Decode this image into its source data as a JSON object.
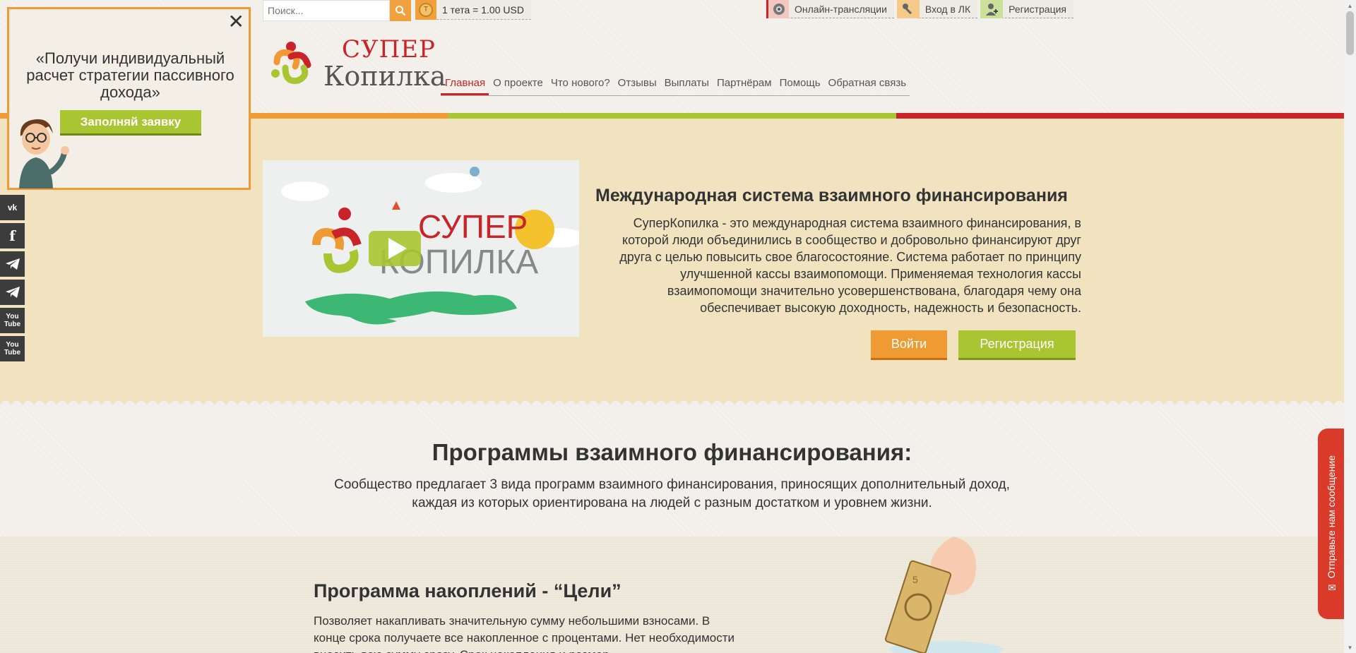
{
  "search": {
    "placeholder": "Поиск..."
  },
  "rate": {
    "coin_symbol": "T",
    "text": "1 тета = 1.00 USD"
  },
  "toplinks": [
    {
      "label": "Онлайн-трансляции",
      "icon": "broadcast-icon"
    },
    {
      "label": "Вход в ЛК",
      "icon": "key-icon"
    },
    {
      "label": "Регистрация",
      "icon": "user-add-icon"
    }
  ],
  "logo": {
    "line1": "СУПЕР",
    "line2": "Копилка"
  },
  "nav": [
    "Главная",
    "О проекте",
    "Что нового?",
    "Отзывы",
    "Выплаты",
    "Партнёрам",
    "Помощь",
    "Обратная связь"
  ],
  "colors": {
    "orange": "#ef9a33",
    "green": "#a9c531",
    "red": "#c8242a",
    "hero_bg": "#f1e3c0"
  },
  "video": {
    "logo_line1": "СУПЕР",
    "logo_line2": "КОПИЛКА"
  },
  "hero": {
    "title": "Международная система взаимного финансирования",
    "description": "СуперКопилка - это международная система взаимного финансирования, в которой люди объединились в сообщество и добровольно финансируют друг друга с целью повысить свое благосостояние. Система работает по принципу улучшенной кассы взаимопомощи. Применяемая технология кассы взаимопомощи значительно усовершенствована, благодаря чему она обеспечивает высокую доходность, надежность и безопасность.",
    "login_button": "Войти",
    "register_button": "Регистрация"
  },
  "programs": {
    "title": "Программы взаимного финансирования:",
    "text_line1": "Сообщество предлагает 3 вида программ взаимного финансирования, приносящих дополнительный доход,",
    "text_line2": "каждая из которых ориентирована на людей с разным достатком и уровнем жизни."
  },
  "savings": {
    "title": "Программа накоплений - “Цели”",
    "text": "Позволяет накапливать значительную сумму небольшими взносами. В конце срока получаете все накопленное с процентами. Нет необходимости вносить всю сумму сразу. Срок накопления и размер"
  },
  "popup": {
    "close": "✕",
    "text": "«Получи индивидуальный расчет стратегии пассивного дохода»",
    "button": "Заполняй заявку"
  },
  "social": [
    "vk-icon",
    "facebook-icon",
    "telegram-icon",
    "telegram-icon",
    "youtube-icon",
    "youtube-icon"
  ],
  "social_labels": {
    "vk": "vk",
    "fb": "f",
    "yt1": "You",
    "yt2": "Tube"
  },
  "feedback": {
    "label": "✉ Отправьте нам сообщение"
  }
}
